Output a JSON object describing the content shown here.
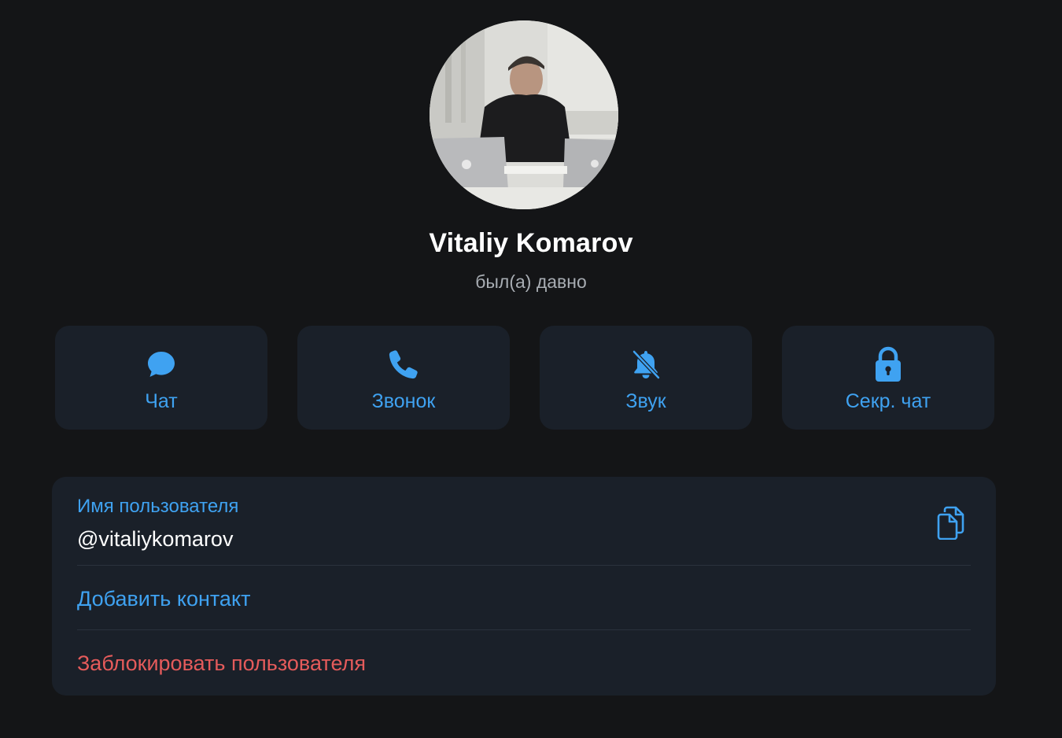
{
  "profile": {
    "name": "Vitaliy Komarov",
    "status": "был(а) давно",
    "avatar_icon": "profile-photo"
  },
  "actions": [
    {
      "label": "Чат",
      "icon": "chat-bubble-icon"
    },
    {
      "label": "Звонок",
      "icon": "phone-icon"
    },
    {
      "label": "Звук",
      "icon": "bell-muted-icon"
    },
    {
      "label": "Секр. чат",
      "icon": "lock-icon"
    }
  ],
  "info": {
    "username_caption": "Имя пользователя",
    "username_value": "@vitaliykomarov",
    "add_contact": "Добавить контакт",
    "block_user": "Заблокировать пользователя"
  },
  "colors": {
    "background": "#141517",
    "card": "#1a2029",
    "accent": "#3fa2f1",
    "danger": "#e55b5b"
  }
}
